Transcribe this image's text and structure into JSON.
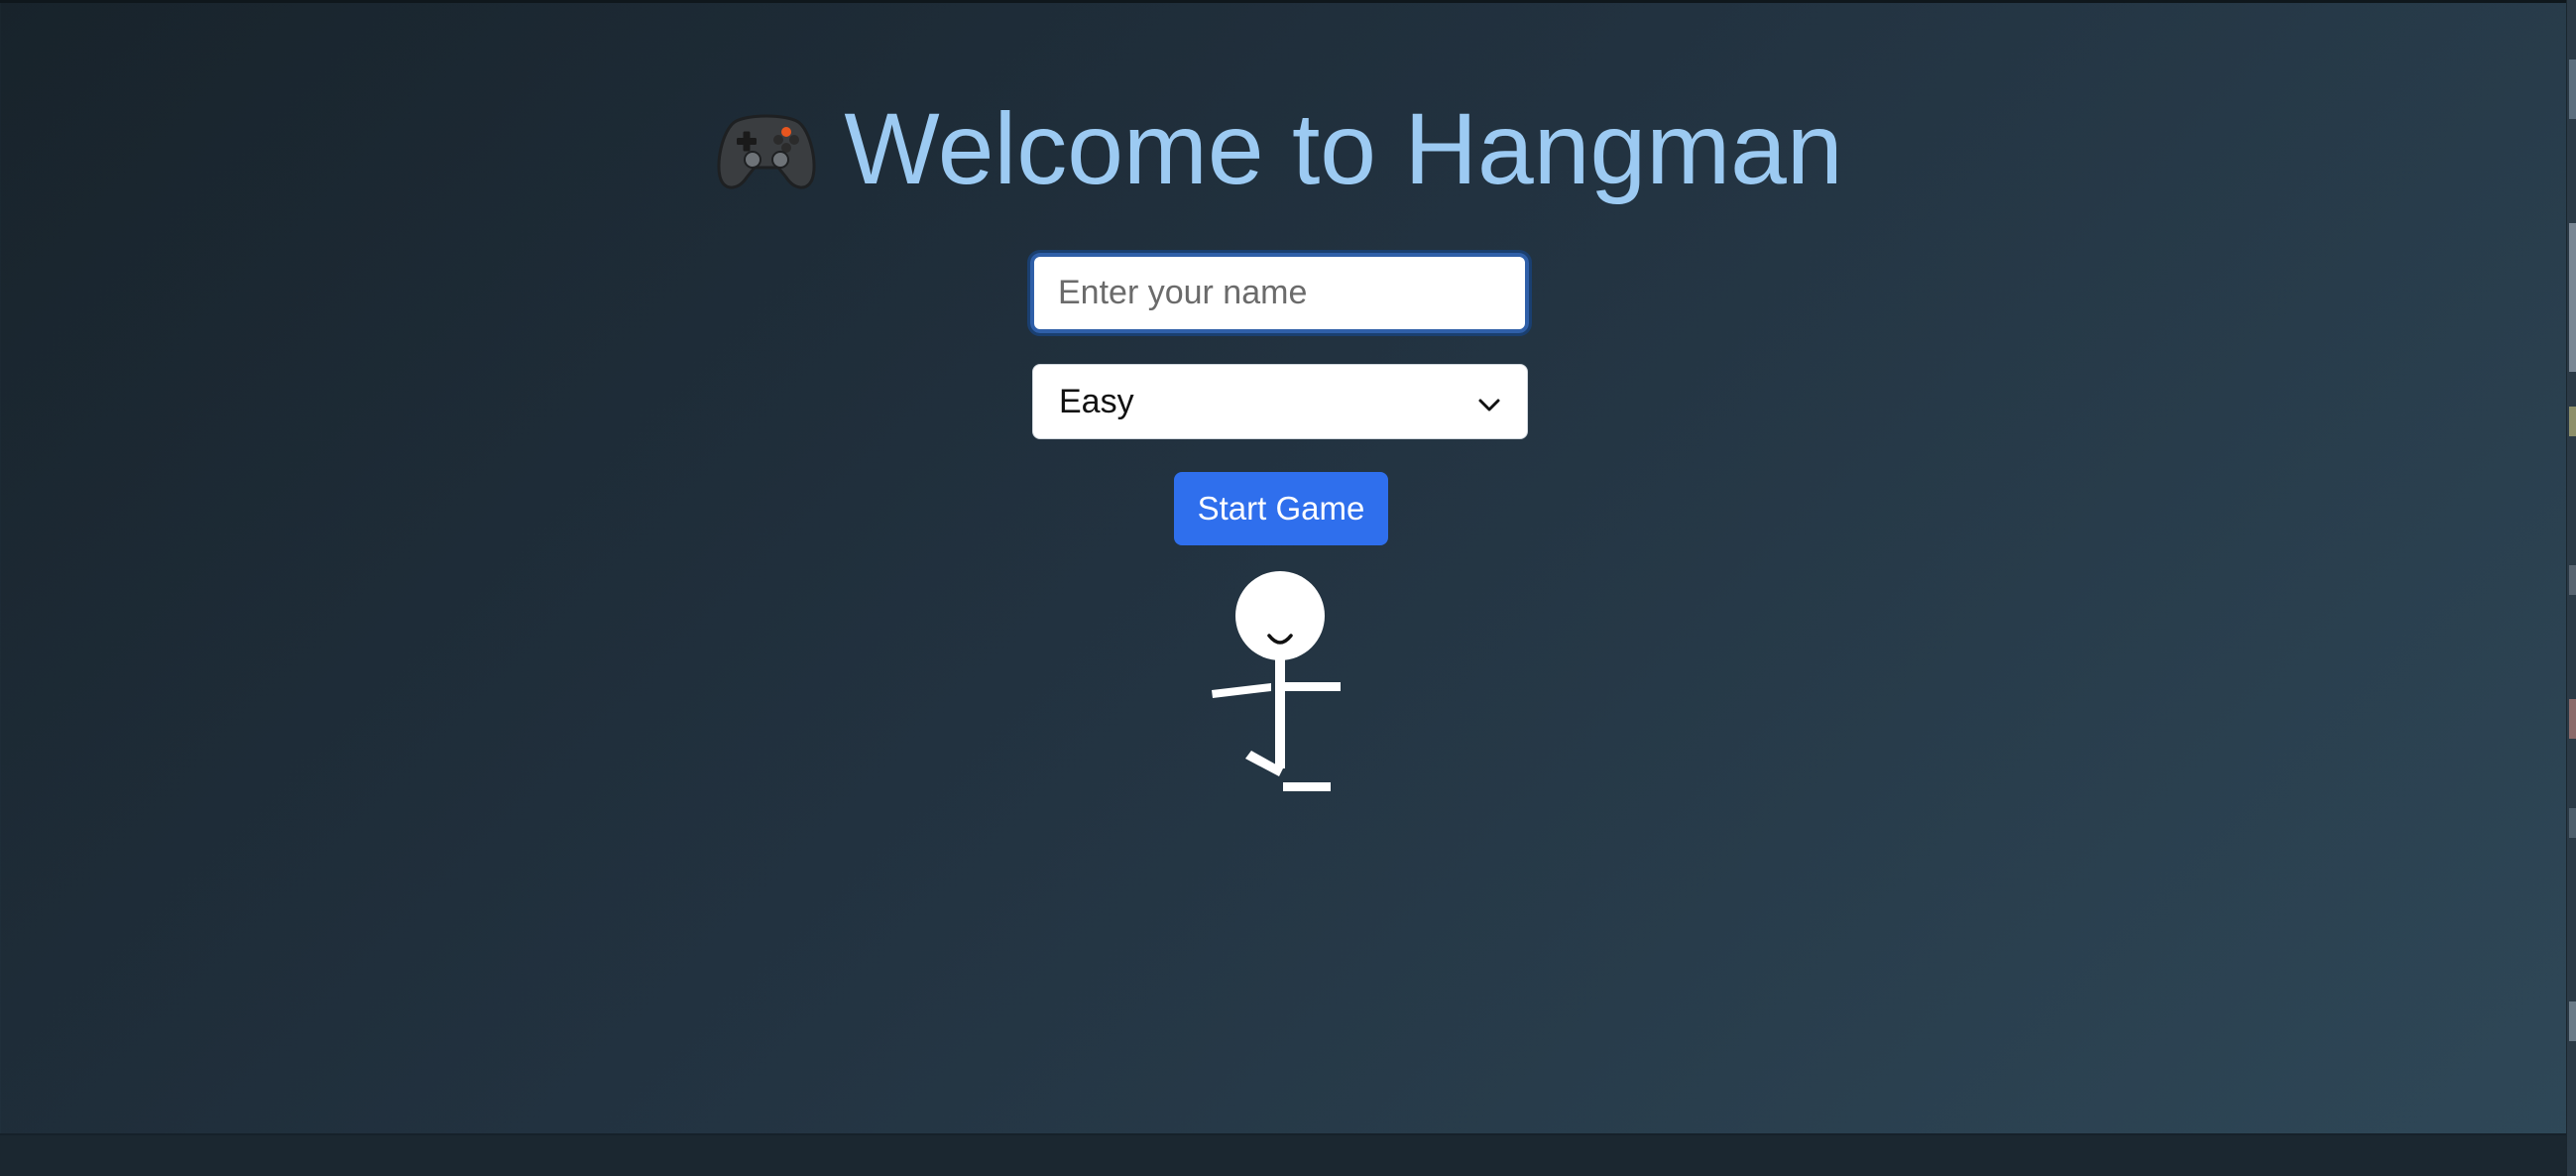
{
  "title": {
    "icon": "gamepad-icon",
    "text": "Welcome to Hangman",
    "color": "#9ccaf2"
  },
  "name_input": {
    "placeholder": "Enter your name",
    "value": ""
  },
  "difficulty_select": {
    "selected": "Easy",
    "icon": "chevron-down-icon"
  },
  "start_button": {
    "label": "Start Game",
    "color": "#2f6fed"
  },
  "stickman": {
    "icon": "stickman-figure",
    "expression": "smile"
  },
  "colors": {
    "background_start": "#18232b",
    "background_end": "#2f4858"
  }
}
